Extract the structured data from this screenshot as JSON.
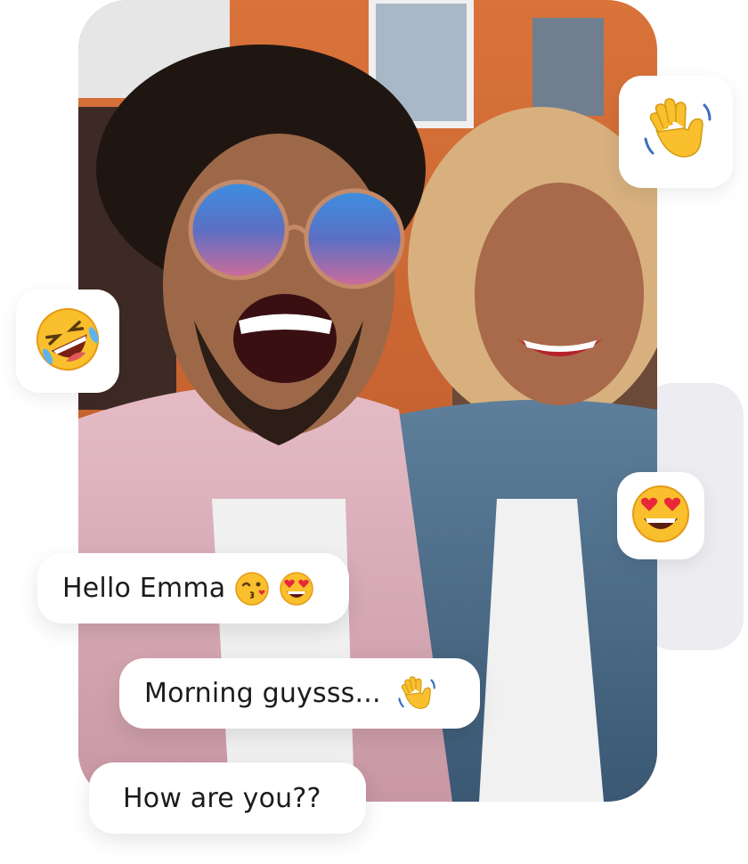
{
  "messages": [
    {
      "text": "Hello Emma",
      "emojis": [
        "kissing-face-icon",
        "heart-eyes-icon"
      ]
    },
    {
      "text": "Morning guysss...",
      "emojis": [
        "waving-hand-icon"
      ]
    },
    {
      "text": "How are you??",
      "emojis": []
    }
  ],
  "floating_reactions": [
    "waving-hand-icon",
    "rolling-laughing-icon",
    "heart-eyes-icon"
  ],
  "colors": {
    "building_orange": "#cf6a34",
    "pink_jacket": "#d9aeb8",
    "denim": "#4a6d8a",
    "bubble_bg": "#ffffff",
    "side_card": "#ececf1",
    "emoji_yellow": "#f9bf2c"
  }
}
